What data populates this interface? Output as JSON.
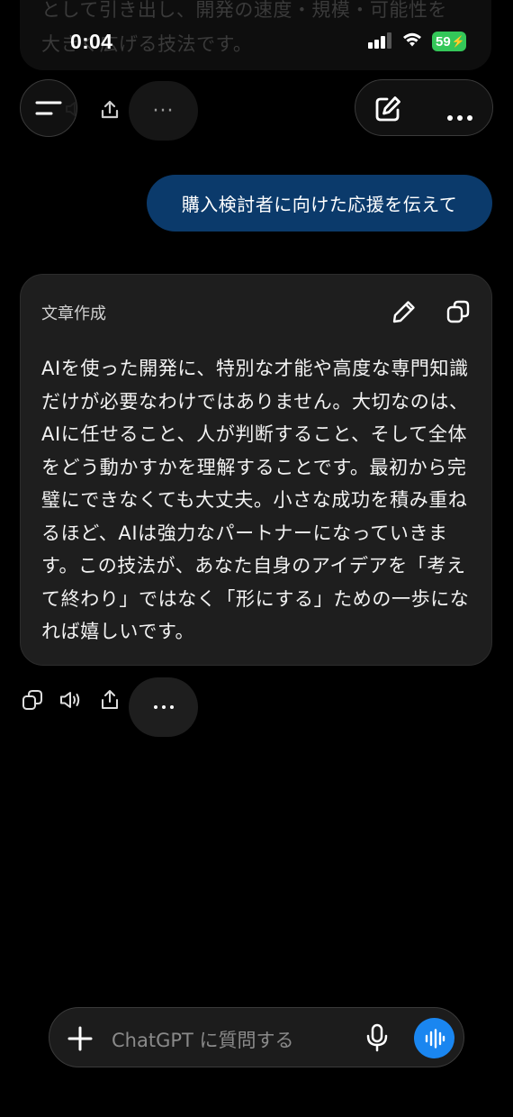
{
  "previous_message": {
    "line1": "として引き出し、開発の速度・規模・可能性を",
    "line2": "大きく広げる技法です。"
  },
  "status_bar": {
    "time": "0:04",
    "battery": "59"
  },
  "user_message": "購入検討者に向けた応援を伝えて",
  "assistant_card": {
    "label": "文章作成",
    "text": "AIを使った開発に、特別な才能や高度な専門知識だけが必要なわけではありません。大切なのは、AIに任せること、人が判断すること、そして全体をどう動かすかを理解することです。最初から完璧にできなくても大丈夫。小さな成功を積み重ねるほど、AIは強力なパートナーになっていきます。この技法が、あなた自身のアイデアを「考えて終わり」ではなく「形にする」ための一歩になれば嬉しいです。"
  },
  "composer": {
    "placeholder": "ChatGPT に質問する"
  },
  "colors": {
    "user_bubble": "#0b3a6b",
    "voice_button": "#1a86f0",
    "battery": "#34c759"
  }
}
